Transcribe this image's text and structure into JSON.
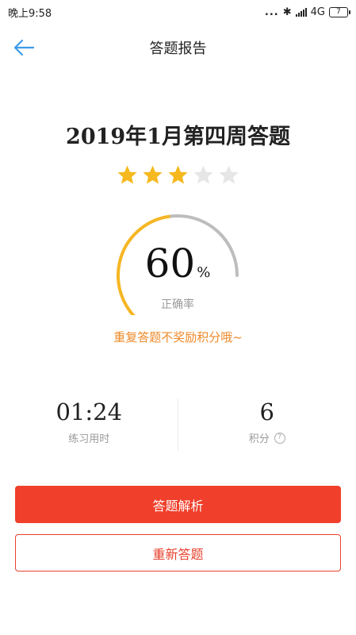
{
  "status_bar": {
    "time": "晚上9:58",
    "dots": "...",
    "bluetooth": "✱",
    "network": "4G",
    "battery": "7"
  },
  "header": {
    "title": "答题报告",
    "back_icon": "arrow-left-icon"
  },
  "quiz": {
    "title": "2019年1月第四周答题",
    "stars_filled": 3,
    "stars_total": 5
  },
  "gauge": {
    "value": "60",
    "unit": "%",
    "label": "正确率",
    "fraction": 0.6
  },
  "note": "重复答题不奖励积分哦~",
  "stats": {
    "time_value": "01:24",
    "time_label": "练习用时",
    "points_value": "6",
    "points_label": "积分",
    "help_glyph": "?"
  },
  "buttons": {
    "analysis": "答题解析",
    "retry": "重新答题"
  },
  "colors": {
    "accent": "#f03f2a",
    "star_on": "#f5b81e",
    "star_off": "#e6e6e6",
    "gauge_on": "#f5b623",
    "gauge_off": "#bdbdbd",
    "note": "#ee8a2a",
    "back": "#3d9be9"
  }
}
